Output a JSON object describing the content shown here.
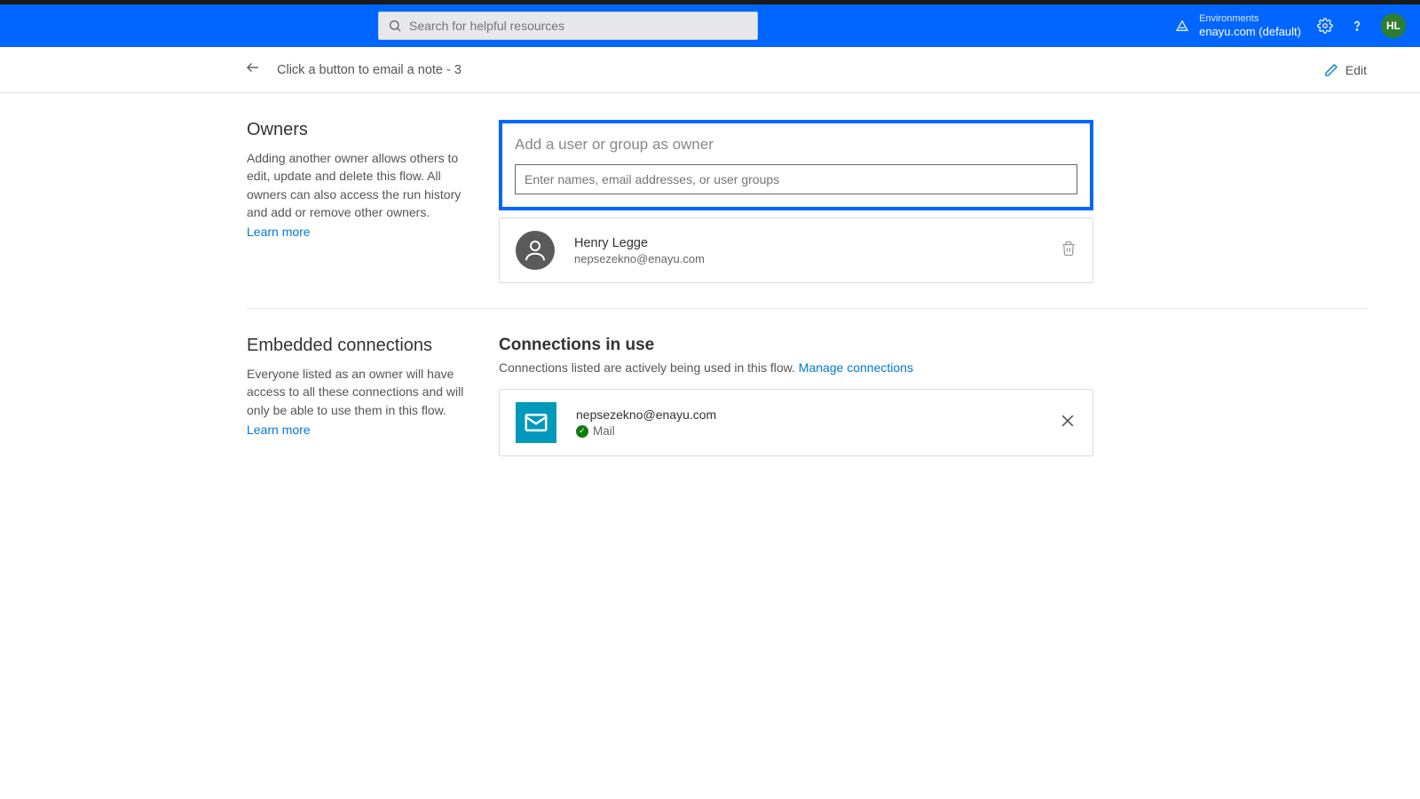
{
  "topbar": {
    "search_placeholder": "Search for helpful resources",
    "env_label": "Environments",
    "env_name": "enayu.com (default)",
    "avatar_initials": "HL"
  },
  "pagebar": {
    "title": "Click a button to email a note - 3",
    "edit_label": "Edit"
  },
  "owners": {
    "heading": "Owners",
    "desc": "Adding another owner allows others to edit, update and delete this flow. All owners can also access the run history and add or remove other owners.",
    "learn": "Learn more",
    "add_title": "Add a user or group as owner",
    "add_placeholder": "Enter names, email addresses, or user groups",
    "list": [
      {
        "name": "Henry Legge",
        "email": "nepsezekno@enayu.com"
      }
    ]
  },
  "connections": {
    "heading": "Embedded connections",
    "desc": "Everyone listed as an owner will have access to all these connections and will only be able to use them in this flow.",
    "learn": "Learn more",
    "right_heading": "Connections in use",
    "right_sub": "Connections listed are actively being used in this flow. ",
    "manage_link": "Manage connections",
    "list": [
      {
        "email": "nepsezekno@enayu.com",
        "label": "Mail"
      }
    ]
  }
}
